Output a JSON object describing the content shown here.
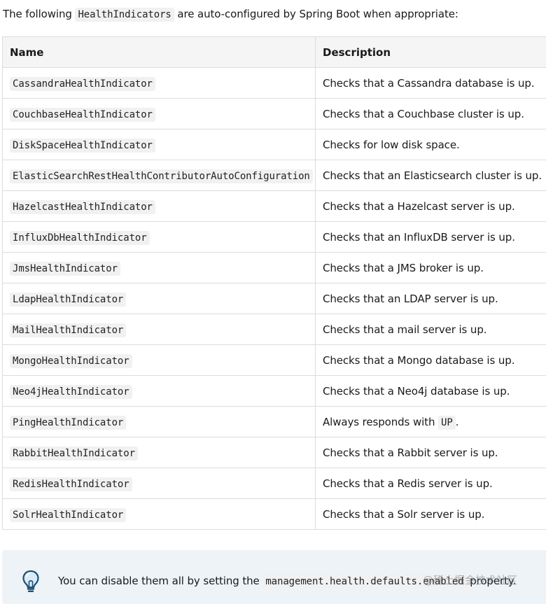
{
  "intro": {
    "prefix": "The following ",
    "code": "HealthIndicators",
    "suffix": " are auto-configured by Spring Boot when appropriate:"
  },
  "table": {
    "headers": [
      "Name",
      "Description"
    ],
    "rows": [
      {
        "name": "CassandraHealthIndicator",
        "desc_pre": "Checks that a Cassandra database is up.",
        "desc_code": "",
        "desc_post": ""
      },
      {
        "name": "CouchbaseHealthIndicator",
        "desc_pre": "Checks that a Couchbase cluster is up.",
        "desc_code": "",
        "desc_post": ""
      },
      {
        "name": "DiskSpaceHealthIndicator",
        "desc_pre": "Checks for low disk space.",
        "desc_code": "",
        "desc_post": ""
      },
      {
        "name": "ElasticSearchRestHealthContributorAutoConfiguration",
        "desc_pre": "Checks that an Elasticsearch cluster is up.",
        "desc_code": "",
        "desc_post": ""
      },
      {
        "name": "HazelcastHealthIndicator",
        "desc_pre": "Checks that a Hazelcast server is up.",
        "desc_code": "",
        "desc_post": ""
      },
      {
        "name": "InfluxDbHealthIndicator",
        "desc_pre": "Checks that an InfluxDB server is up.",
        "desc_code": "",
        "desc_post": ""
      },
      {
        "name": "JmsHealthIndicator",
        "desc_pre": "Checks that a JMS broker is up.",
        "desc_code": "",
        "desc_post": ""
      },
      {
        "name": "LdapHealthIndicator",
        "desc_pre": "Checks that an LDAP server is up.",
        "desc_code": "",
        "desc_post": ""
      },
      {
        "name": "MailHealthIndicator",
        "desc_pre": "Checks that a mail server is up.",
        "desc_code": "",
        "desc_post": ""
      },
      {
        "name": "MongoHealthIndicator",
        "desc_pre": "Checks that a Mongo database is up.",
        "desc_code": "",
        "desc_post": ""
      },
      {
        "name": "Neo4jHealthIndicator",
        "desc_pre": "Checks that a Neo4j database is up.",
        "desc_code": "",
        "desc_post": ""
      },
      {
        "name": "PingHealthIndicator",
        "desc_pre": "Always responds with ",
        "desc_code": "UP",
        "desc_post": "."
      },
      {
        "name": "RabbitHealthIndicator",
        "desc_pre": "Checks that a Rabbit server is up.",
        "desc_code": "",
        "desc_post": ""
      },
      {
        "name": "RedisHealthIndicator",
        "desc_pre": "Checks that a Redis server is up.",
        "desc_code": "",
        "desc_post": ""
      },
      {
        "name": "SolrHealthIndicator",
        "desc_pre": "Checks that a Solr server is up.",
        "desc_code": "",
        "desc_post": ""
      }
    ]
  },
  "tip": {
    "icon": "lightbulb-icon",
    "prefix": "You can disable them all by setting the ",
    "code": "management.health.defaults.enabled",
    "suffix": " property."
  },
  "watermark": "@稀土掘金技术社区",
  "colors": {
    "tip_background": "#eef3f7",
    "header_background": "#f5f5f5",
    "code_background": "#f1f1f1",
    "border": "#dcdcdc",
    "icon_stroke": "#1e4f72"
  }
}
